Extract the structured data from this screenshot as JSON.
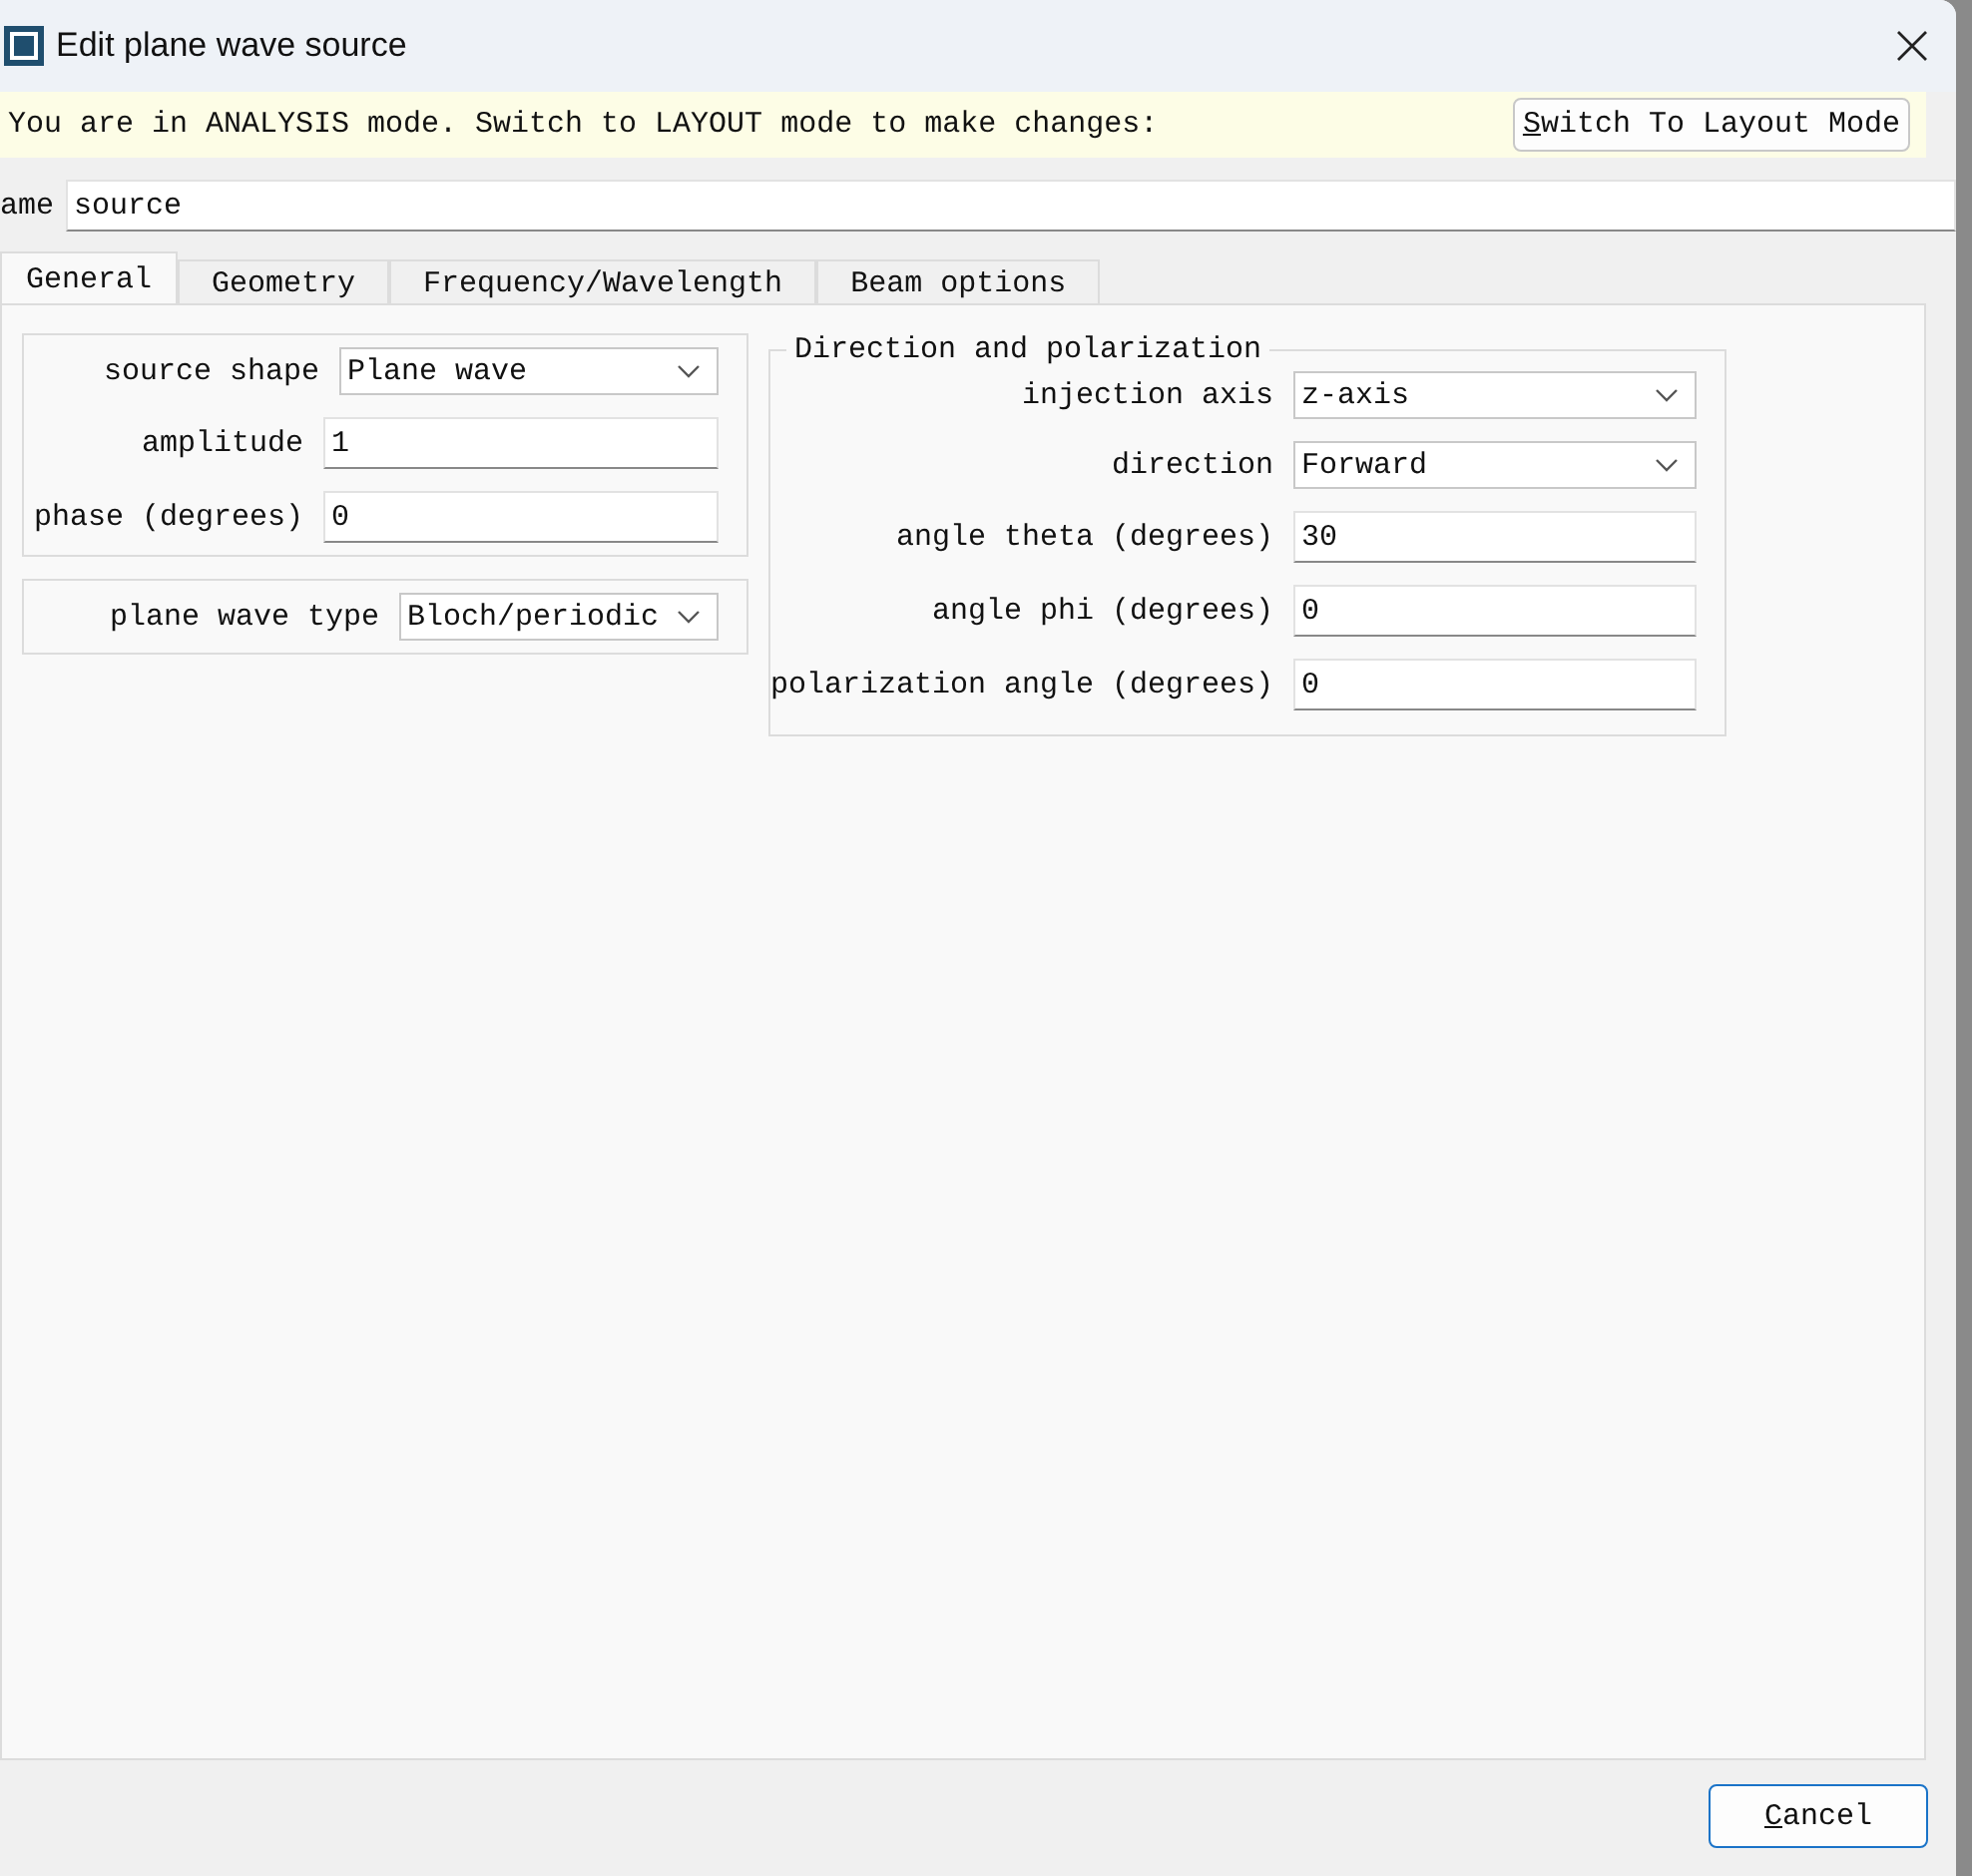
{
  "window": {
    "title": "Edit plane wave source"
  },
  "banner": {
    "message": "You are in ANALYSIS mode.  Switch to LAYOUT mode to make changes:",
    "button": "Switch To Layout Mode"
  },
  "name_field": {
    "label": "ame",
    "value": "source"
  },
  "tabs": [
    {
      "label": "General",
      "selected": true
    },
    {
      "label": "Geometry",
      "selected": false
    },
    {
      "label": "Frequency/Wavelength",
      "selected": false
    },
    {
      "label": "Beam options",
      "selected": false
    }
  ],
  "left_groups": [
    {
      "rows": [
        {
          "label": "source shape",
          "kind": "dropdown",
          "value": "Plane wave"
        },
        {
          "label": "amplitude",
          "kind": "text",
          "value": "1"
        },
        {
          "label": "phase (degrees)",
          "kind": "text",
          "value": "0"
        }
      ]
    },
    {
      "rows": [
        {
          "label": "plane wave type",
          "kind": "dropdown",
          "value": "Bloch/periodic"
        }
      ]
    }
  ],
  "direction_group": {
    "title": "Direction and polarization",
    "rows": [
      {
        "label": "injection axis",
        "kind": "dropdown",
        "value": "z-axis"
      },
      {
        "label": "direction",
        "kind": "dropdown",
        "value": "Forward"
      },
      {
        "label": "angle theta (degrees)",
        "kind": "text",
        "value": "30"
      },
      {
        "label": "angle phi (degrees)",
        "kind": "text",
        "value": "0"
      },
      {
        "label": "polarization angle (degrees)",
        "kind": "text",
        "value": "0"
      }
    ]
  },
  "buttons": {
    "cancel": "Cancel"
  }
}
